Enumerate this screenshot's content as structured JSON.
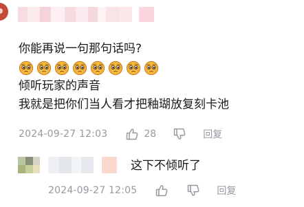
{
  "comment": {
    "lines": [
      "你能再说一句那句话吗?",
      "倾听玩家的声音",
      "我就是把你们当人看才把釉瑚放复刻卡池"
    ],
    "emojis": [
      "pleading-face-emoji",
      "pleading-face-emoji",
      "pleading-face-emoji",
      "pleading-face-emoji",
      "pleading-face-emoji",
      "pleading-face-emoji",
      "pleading-face-emoji",
      "pleading-face-emoji"
    ],
    "time": "2024-09-27 12:03",
    "likes": "28",
    "reply_label": "回复"
  },
  "reply": {
    "text": "这下不倾听了",
    "time": "2024-09-27 12:05",
    "reply_label": "回复"
  },
  "colors": {
    "text": "#18191c",
    "meta": "#9499a0",
    "emoji_face": "#f6b93b",
    "emoji_outline": "#c8781a"
  },
  "icons": {
    "like": "thumbs-up-icon",
    "dislike": "thumbs-down-icon"
  }
}
